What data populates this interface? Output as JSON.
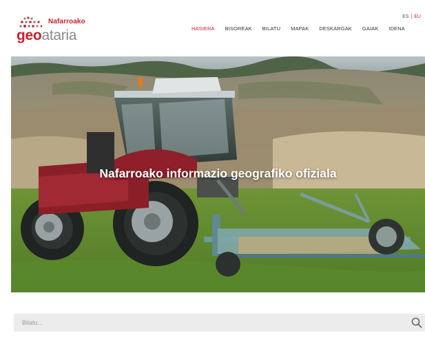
{
  "brand": {
    "subtitle": "Nafarroako",
    "name_part1": "geo",
    "name_part2": "ataria",
    "logo_dot_colors": [
      "#c8202f",
      "#8a8a8a"
    ]
  },
  "language": {
    "options": [
      "ES",
      "EU"
    ],
    "separator": "|",
    "selected": "EU"
  },
  "nav": {
    "items": [
      "HASIERA",
      "BISOREAK",
      "BILATU",
      "MAPAK",
      "DESKARGAK",
      "GAIAK",
      "IDENA"
    ],
    "active": "HASIERA"
  },
  "hero": {
    "title": "Nafarroako informazio geografiko ofiziala",
    "image": "tractor-in-field-photo"
  },
  "search": {
    "placeholder": "Bilatu...",
    "value": "",
    "icon": "search-icon"
  },
  "colors": {
    "accent": "#c8202f",
    "nav_text": "#333333",
    "search_bg": "#ececec"
  }
}
